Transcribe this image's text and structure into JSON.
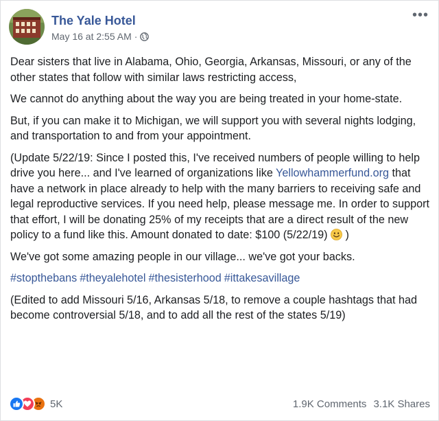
{
  "post": {
    "page_name": "The Yale Hotel",
    "timestamp": "May 16 at 2:55 AM",
    "separator": "·",
    "more_label": "•••",
    "body": {
      "p1": "Dear sisters that live in Alabama, Ohio, Georgia, Arkansas, Missouri, or any of the other states that follow with similar laws restricting access,",
      "p2": "We cannot do anything about the way you are being treated in your home-state.",
      "p3": "But, if you can make it to Michigan, we will support you with several nights lodging, and transportation to and from your appointment.",
      "p4_before_link": "(Update 5/22/19: Since I posted this, I've received numbers of people willing to help drive you here... and I've learned of organizations like ",
      "p4_link": "Yellowhammerfund.org",
      "p4_after_link": " that have a network in place already to help with the many barriers to receiving safe and legal reproductive services. If you need help, please message me. In order to support that effort, I will be donating 25% of my receipts that are a direct result of the new policy to a fund like this. Amount donated to date: $100 (5/22/19) ",
      "p4_end": " )",
      "p5": "We've got some amazing people in our village... we've got your backs.",
      "hashtags": [
        "#stopthebans",
        "#theyalehotel",
        "#thesisterhood",
        "#ittakesavillage"
      ],
      "p6": "(Edited to add Missouri 5/16, Arkansas 5/18, to remove a couple hashtags that had become controversial 5/18, and to add all the rest of the states 5/19)"
    },
    "footer": {
      "reaction_count": "5K",
      "comments": "1.9K Comments",
      "shares": "3.1K Shares"
    }
  },
  "colors": {
    "link": "#385898",
    "text": "#1c1e21",
    "meta": "#606770",
    "like": "#1877f2",
    "love": "#f33e58",
    "angry": "#e9710f"
  },
  "icons": {
    "privacy": "globe-icon",
    "more": "more-options-icon",
    "reactions": [
      "like-icon",
      "love-icon",
      "angry-icon"
    ],
    "emoji": "smile-emoji-icon"
  }
}
